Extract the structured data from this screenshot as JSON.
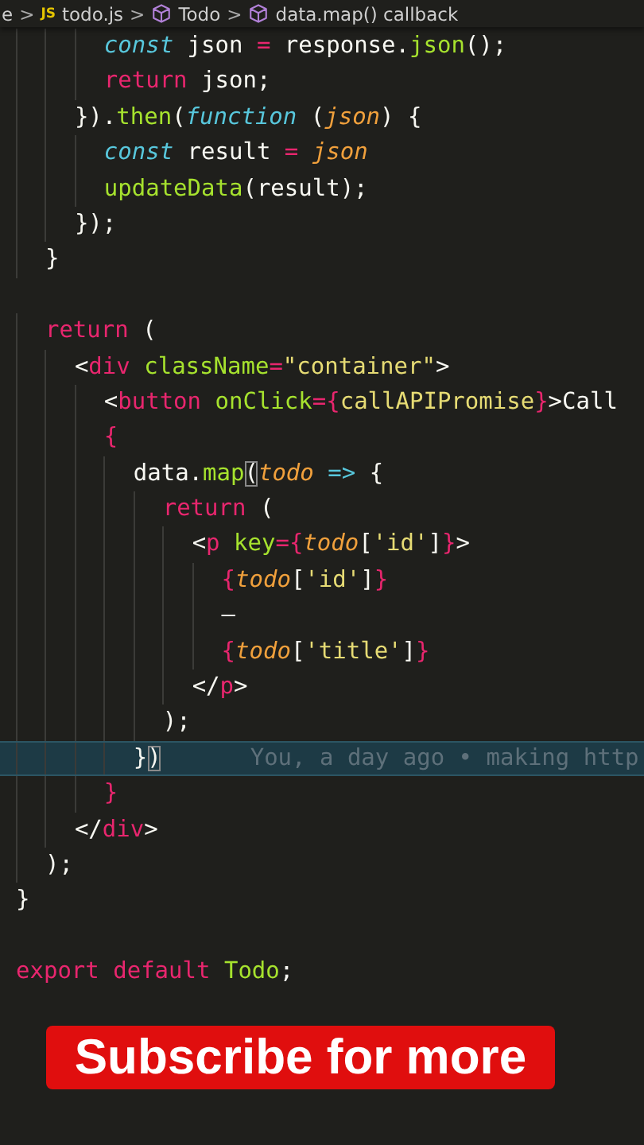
{
  "breadcrumb": [
    {
      "text": "e",
      "kind": "folder"
    },
    {
      "text": "todo.js",
      "kind": "file",
      "badge": "JS"
    },
    {
      "text": "Todo",
      "kind": "symbol"
    },
    {
      "text": "data.map() callback",
      "kind": "symbol"
    }
  ],
  "breadcrumb_separator": ">",
  "code_lines": [
    {
      "kind": "code",
      "tokens": [
        {
          "text": "      const",
          "kind": "storage"
        },
        {
          "text": " json ",
          "kind": "plain"
        },
        {
          "text": "=",
          "kind": "keyword"
        },
        {
          "text": " response.",
          "kind": "plain"
        },
        {
          "text": "json",
          "kind": "func"
        },
        {
          "text": "();",
          "kind": "plain"
        }
      ]
    },
    {
      "kind": "code",
      "tokens": [
        {
          "text": "      return",
          "kind": "keyword"
        },
        {
          "text": " json;",
          "kind": "plain"
        }
      ]
    },
    {
      "kind": "code",
      "tokens": [
        {
          "text": "    }).",
          "kind": "plain"
        },
        {
          "text": "then",
          "kind": "func"
        },
        {
          "text": "(",
          "kind": "plain"
        },
        {
          "text": "function",
          "kind": "storage"
        },
        {
          "text": " (",
          "kind": "plain"
        },
        {
          "text": "json",
          "kind": "param"
        },
        {
          "text": ") {",
          "kind": "plain"
        }
      ]
    },
    {
      "kind": "code",
      "tokens": [
        {
          "text": "      const",
          "kind": "storage"
        },
        {
          "text": " result ",
          "kind": "plain"
        },
        {
          "text": "= ",
          "kind": "keyword"
        },
        {
          "text": "json",
          "kind": "param"
        }
      ]
    },
    {
      "kind": "code",
      "tokens": [
        {
          "text": "      updateData",
          "kind": "func"
        },
        {
          "text": "(result);",
          "kind": "plain"
        }
      ]
    },
    {
      "kind": "code",
      "tokens": [
        {
          "text": "    });",
          "kind": "plain"
        }
      ]
    },
    {
      "kind": "code",
      "tokens": [
        {
          "text": "  }",
          "kind": "plain"
        }
      ]
    },
    {
      "kind": "blank"
    },
    {
      "kind": "code",
      "tokens": [
        {
          "text": "  return",
          "kind": "keyword"
        },
        {
          "text": " (",
          "kind": "plain"
        }
      ]
    },
    {
      "kind": "code",
      "tokens": [
        {
          "text": "    <",
          "kind": "plain"
        },
        {
          "text": "div",
          "kind": "keyword"
        },
        {
          "text": " className",
          "kind": "func"
        },
        {
          "text": "=",
          "kind": "keyword"
        },
        {
          "text": "\"container\"",
          "kind": "string"
        },
        {
          "text": ">",
          "kind": "plain"
        }
      ]
    },
    {
      "kind": "code",
      "tokens": [
        {
          "text": "      <",
          "kind": "plain"
        },
        {
          "text": "button",
          "kind": "keyword"
        },
        {
          "text": " onClick",
          "kind": "func"
        },
        {
          "text": "=",
          "kind": "keyword"
        },
        {
          "text": "{",
          "kind": "keyword"
        },
        {
          "text": "callAPIPromise",
          "kind": "string"
        },
        {
          "text": "}",
          "kind": "keyword"
        },
        {
          "text": ">Call",
          "kind": "plain"
        }
      ]
    },
    {
      "kind": "code",
      "tokens": [
        {
          "text": "      {",
          "kind": "keyword"
        }
      ]
    },
    {
      "kind": "code",
      "tokens": [
        {
          "text": "        data.",
          "kind": "plain"
        },
        {
          "text": "map",
          "kind": "func"
        },
        {
          "text": "(",
          "kind": "match"
        },
        {
          "text": "todo",
          "kind": "param"
        },
        {
          "text": " =>",
          "kind": "storage"
        },
        {
          "text": " {",
          "kind": "plain"
        }
      ]
    },
    {
      "kind": "code",
      "tokens": [
        {
          "text": "          return",
          "kind": "keyword"
        },
        {
          "text": " (",
          "kind": "plain"
        }
      ]
    },
    {
      "kind": "code",
      "tokens": [
        {
          "text": "            <",
          "kind": "plain"
        },
        {
          "text": "p",
          "kind": "keyword"
        },
        {
          "text": " key",
          "kind": "func"
        },
        {
          "text": "=",
          "kind": "keyword"
        },
        {
          "text": "{",
          "kind": "keyword"
        },
        {
          "text": "todo",
          "kind": "param"
        },
        {
          "text": "[",
          "kind": "plain"
        },
        {
          "text": "'id'",
          "kind": "string"
        },
        {
          "text": "]",
          "kind": "plain"
        },
        {
          "text": "}",
          "kind": "keyword"
        },
        {
          "text": ">",
          "kind": "plain"
        }
      ]
    },
    {
      "kind": "code",
      "tokens": [
        {
          "text": "              {",
          "kind": "keyword"
        },
        {
          "text": "todo",
          "kind": "param"
        },
        {
          "text": "[",
          "kind": "plain"
        },
        {
          "text": "'id'",
          "kind": "string"
        },
        {
          "text": "]",
          "kind": "plain"
        },
        {
          "text": "}",
          "kind": "keyword"
        }
      ]
    },
    {
      "kind": "code",
      "tokens": [
        {
          "text": "              –",
          "kind": "plain"
        }
      ]
    },
    {
      "kind": "code",
      "tokens": [
        {
          "text": "              {",
          "kind": "keyword"
        },
        {
          "text": "todo",
          "kind": "param"
        },
        {
          "text": "[",
          "kind": "plain"
        },
        {
          "text": "'title'",
          "kind": "string"
        },
        {
          "text": "]",
          "kind": "plain"
        },
        {
          "text": "}",
          "kind": "keyword"
        }
      ]
    },
    {
      "kind": "code",
      "tokens": [
        {
          "text": "            </",
          "kind": "plain"
        },
        {
          "text": "p",
          "kind": "keyword"
        },
        {
          "text": ">",
          "kind": "plain"
        }
      ]
    },
    {
      "kind": "code",
      "tokens": [
        {
          "text": "          );",
          "kind": "plain"
        }
      ]
    },
    {
      "kind": "code",
      "highlighted": true,
      "blame": "You, a day ago • making http",
      "tokens": [
        {
          "text": "        }",
          "kind": "plain"
        },
        {
          "text": ")",
          "kind": "match"
        }
      ]
    },
    {
      "kind": "code",
      "tokens": [
        {
          "text": "      }",
          "kind": "keyword"
        }
      ]
    },
    {
      "kind": "code",
      "tokens": [
        {
          "text": "    </",
          "kind": "plain"
        },
        {
          "text": "div",
          "kind": "keyword"
        },
        {
          "text": ">",
          "kind": "plain"
        }
      ]
    },
    {
      "kind": "code",
      "tokens": [
        {
          "text": "  );",
          "kind": "plain"
        }
      ]
    },
    {
      "kind": "code",
      "tokens": [
        {
          "text": "}",
          "kind": "plain"
        }
      ]
    },
    {
      "kind": "blank"
    },
    {
      "kind": "code",
      "tokens": [
        {
          "text": "export",
          "kind": "keyword"
        },
        {
          "text": " default",
          "kind": "keyword"
        },
        {
          "text": " Todo",
          "kind": "func"
        },
        {
          "text": ";",
          "kind": "plain"
        }
      ]
    }
  ],
  "overlay_banner": {
    "text": "Subscribe for more"
  }
}
